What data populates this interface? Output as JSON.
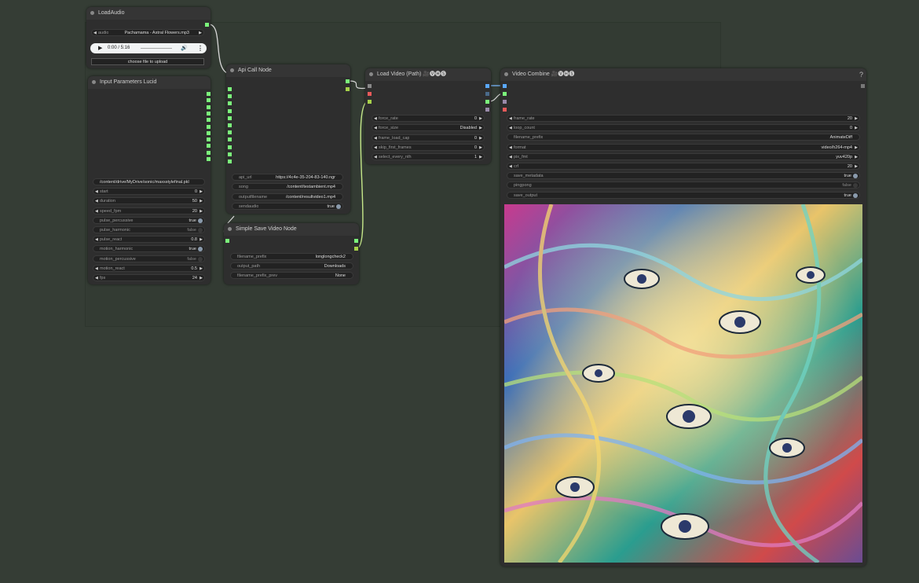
{
  "nodes": {
    "load_audio": {
      "title": "LoadAudio",
      "audio_label": "audio",
      "audio_value": "Pachamama - Astral Flowers.mp3",
      "player_time": "0:00 / 5:16",
      "upload_label": "choose file to upload"
    },
    "input_params": {
      "title": "Input Parameters Lucid",
      "widgets": [
        {
          "label": "",
          "value": "/content/drive/MyDrive/sonic/maxsstylefinal.pkl",
          "kind": "text"
        },
        {
          "label": "start",
          "value": "0",
          "kind": "number"
        },
        {
          "label": "duration",
          "value": "50",
          "kind": "number"
        },
        {
          "label": "speed_fpm",
          "value": "20",
          "kind": "number"
        },
        {
          "label": "pulse_percussive",
          "value": "true",
          "kind": "toggle"
        },
        {
          "label": "pulse_harmonic",
          "value": "false",
          "kind": "toggle-off"
        },
        {
          "label": "pulse_react",
          "value": "0.8",
          "kind": "number"
        },
        {
          "label": "motion_harmonic",
          "value": "true",
          "kind": "toggle"
        },
        {
          "label": "motion_percussive",
          "value": "false",
          "kind": "toggle-off"
        },
        {
          "label": "motion_react",
          "value": "0.5",
          "kind": "number"
        },
        {
          "label": "fps",
          "value": "24",
          "kind": "number"
        }
      ]
    },
    "api_call": {
      "title": "Api Call Node",
      "widgets": [
        {
          "label": "api_url",
          "value": "https://4c4e-35-204-83-140.ngr",
          "kind": "text"
        },
        {
          "label": "song",
          "value": "/content/testambient.mp4",
          "kind": "text"
        },
        {
          "label": "outputfilename",
          "value": "/content/resultvideo1.mp4",
          "kind": "text"
        },
        {
          "label": "sendaudio",
          "value": "true",
          "kind": "toggle"
        }
      ]
    },
    "simple_save": {
      "title": "Simple Save Video Node",
      "widgets": [
        {
          "label": "filename_prefix",
          "value": "longlongcheck2",
          "kind": "text"
        },
        {
          "label": "output_path",
          "value": "Downloads",
          "kind": "text"
        },
        {
          "label": "filename_prefix_prev",
          "value": "None",
          "kind": "text"
        }
      ]
    },
    "load_video": {
      "title": "Load Video (Path) 🎥🅥🅗🅢",
      "widgets": [
        {
          "label": "force_rate",
          "value": "0",
          "kind": "number"
        },
        {
          "label": "force_size",
          "value": "Disabled",
          "kind": "number"
        },
        {
          "label": "frame_load_cap",
          "value": "0",
          "kind": "number"
        },
        {
          "label": "skip_first_frames",
          "value": "0",
          "kind": "number"
        },
        {
          "label": "select_every_nth",
          "value": "1",
          "kind": "number"
        }
      ]
    },
    "video_combine": {
      "title": "Video Combine 🎥🅥🅗🅢",
      "help": "?",
      "widgets": [
        {
          "label": "frame_rate",
          "value": "20",
          "kind": "number"
        },
        {
          "label": "loop_count",
          "value": "0",
          "kind": "number"
        },
        {
          "label": "filename_prefix",
          "value": "AnimateDiff",
          "kind": "text"
        },
        {
          "label": "format",
          "value": "video/h264-mp4",
          "kind": "number"
        },
        {
          "label": "pix_fmt",
          "value": "yuv420p",
          "kind": "number"
        },
        {
          "label": "crf",
          "value": "20",
          "kind": "number"
        },
        {
          "label": "save_metadata",
          "value": "true",
          "kind": "toggle"
        },
        {
          "label": "pingpong",
          "value": "false",
          "kind": "toggle-off"
        },
        {
          "label": "save_output",
          "value": "true",
          "kind": "toggle"
        }
      ]
    }
  },
  "colors": {
    "canvas": "#353d35",
    "node_bg": "#2e2e2e",
    "slot_green": "#7bf57b",
    "wire": "#c6e88a"
  },
  "icons": {
    "play": "play-icon",
    "volume": "volume-icon",
    "more": "more-vert-icon"
  }
}
